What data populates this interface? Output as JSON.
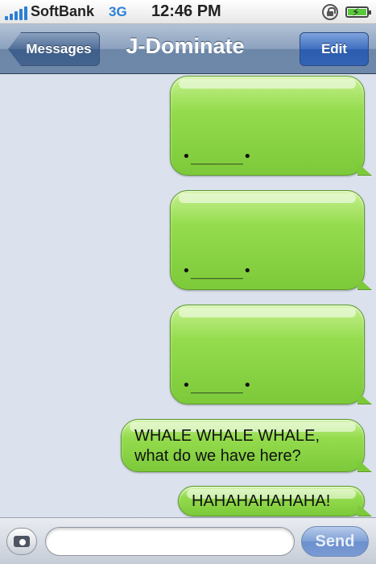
{
  "status_bar": {
    "carrier": "SoftBank",
    "network": "3G",
    "time": "12:46 PM",
    "icons": [
      "signal-icon",
      "rotation-lock-icon",
      "battery-charging-icon"
    ],
    "battery_bolt": "⚡"
  },
  "nav_bar": {
    "back_label": "Messages",
    "title": "J-Dominate",
    "edit_label": "Edit"
  },
  "messages": [
    {
      "type": "sent",
      "text": "•______•"
    },
    {
      "type": "sent",
      "text": "•______•"
    },
    {
      "type": "sent",
      "text": "•______•"
    },
    {
      "type": "sent",
      "text": "WHALE WHALE WHALE, what do we have here?"
    },
    {
      "type": "sent",
      "text": "HAHAHAHAHAHA!"
    }
  ],
  "input_bar": {
    "input_value": "",
    "send_label": "Send"
  },
  "colors": {
    "bubble_green": "#7cc93a",
    "nav_blue": "#6d87a8",
    "background": "#dbe2ed",
    "send_blue": "#6b90ce"
  }
}
